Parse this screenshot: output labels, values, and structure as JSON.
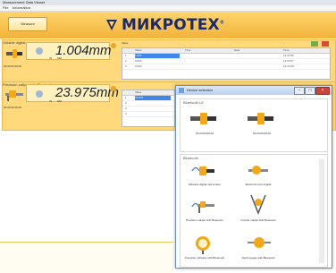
{
  "window": {
    "title": "Measurement Data Viewer"
  },
  "menu": {
    "items": [
      "File",
      "Information"
    ]
  },
  "header": {
    "button_label": "Measure",
    "logo_text": "МИКРОТЕХ",
    "logo_mark": "®"
  },
  "panel1": {
    "title": "Outside digital micrometer",
    "reading": "1.004mm",
    "unit_left": "IN",
    "unit_right": "MM",
    "status": "00:00:00 00:00",
    "table": {
      "headers": [
        "",
        "Value",
        "Time",
        "Date",
        "Time"
      ],
      "rows": [
        [
          "1",
          "1.004",
          "",
          "",
          "12:34:56"
        ],
        [
          "2",
          "0.000",
          "",
          "",
          "12:34:57"
        ],
        [
          "3",
          "0.000",
          "",
          "",
          "12:34:58"
        ]
      ]
    }
  },
  "panel2": {
    "title": "Precision caliper with Bluetooth",
    "reading": "23.975mm",
    "unit_left": "IN",
    "unit_right": "MM",
    "status": "00:00:00 00:00",
    "table": {
      "headers": [
        "",
        "Value",
        "Time",
        "Date",
        "Time"
      ],
      "rows": [
        [
          "1",
          "23.975",
          "",
          "",
          "12:34:56"
        ],
        [
          "2",
          "0.000",
          "",
          "",
          "12:34:57"
        ],
        [
          "3",
          "0.000",
          "",
          "",
          "12:34:58"
        ],
        [
          "4",
          "0.000",
          "",
          "",
          "12:34:59"
        ]
      ]
    }
  },
  "dialog": {
    "title": "Device selection",
    "group1_label": "Bluetooth LE",
    "group1_devices": [
      "00:00:00:00:00",
      "00:00:00:00:00"
    ],
    "group2_label": "Bluetooth",
    "group2_devices": [
      "Wireless digital micrometer",
      "Electronic bore digital",
      "Precision caliper with Bluetooth",
      "Circular caliper with Bluetooth",
      "Precision indicator with Bluetooth",
      "Depth gauge with Bluetooth"
    ]
  },
  "colors": {
    "header": "#f2b23a",
    "panel": "#ffd97c",
    "logo": "#1b2a6b",
    "selection": "#3f86ea"
  }
}
